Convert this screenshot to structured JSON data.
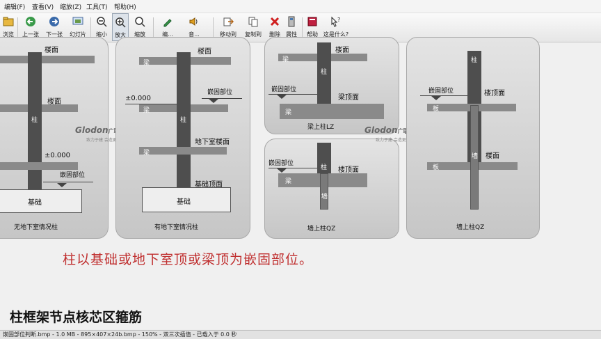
{
  "menu": [
    "编辑(F)",
    "查看(V)",
    "缩放(Z)",
    "工具(T)",
    "帮助(H)"
  ],
  "toolbar": {
    "browse": "浏览",
    "prev": "上一张",
    "next": "下一张",
    "slideshow": "幻灯片",
    "zoom_out": "缩小",
    "zoom_in": "放大",
    "zoom": "缩放",
    "edit": "编...",
    "audio": "音...",
    "move_to": "移动到",
    "copy_to": "复制到",
    "delete": "删除",
    "properties": "属性",
    "help": "帮助",
    "whats_this": "这是什么?"
  },
  "diagram": {
    "p1": {
      "floor_top": "楼面",
      "floor_mid": "楼面",
      "column": "柱",
      "elevation": "±0.000",
      "embed": "嵌固部位",
      "foundation": "基础",
      "caption": "无地下室情况柱"
    },
    "p2": {
      "floor_top": "楼面",
      "beam1": "梁",
      "elevation": "±0.000",
      "embed": "嵌固部位",
      "beam2": "梁",
      "column": "柱",
      "basement_floor": "地下室楼面",
      "beam3": "梁",
      "foundation_top": "基础顶面",
      "foundation": "基础",
      "caption": "有地下室情况柱"
    },
    "p3": {
      "beam_a": "梁",
      "floor_top": "楼面",
      "column": "柱",
      "embed": "嵌固部位",
      "beam_top": "梁顶面",
      "beam_b": "梁",
      "caption": "梁上柱LZ"
    },
    "p4": {
      "embed": "嵌固部位",
      "column": "柱",
      "floor_top": "楼顶面",
      "beam": "梁",
      "wall": "墙",
      "caption": "墙上柱QZ"
    },
    "p5": {
      "column": "柱",
      "embed": "嵌固部位",
      "floor_top": "楼顶面",
      "slab_a": "板",
      "floor": "楼面",
      "slab_b": "板",
      "wall": "墙",
      "caption": "墙上柱QZ"
    },
    "logo": "Glodon",
    "logo_cn": "广联达",
    "logo_sub": "致力于建 会造更多"
  },
  "caption_text": "柱以基础或地下室顶或梁顶为嵌固部位。",
  "heading": "柱框架节点核芯区箍筋",
  "status": "嵌固部位判断.bmp - 1.0 MB - 895×407×24b.bmp - 150% - 双三次插值 - 已载入于 0.0 秒",
  "colors": {
    "caption_red": "#c03030",
    "column_dark": "#4e4e4e",
    "panel_gray": "#d4d4d4"
  }
}
